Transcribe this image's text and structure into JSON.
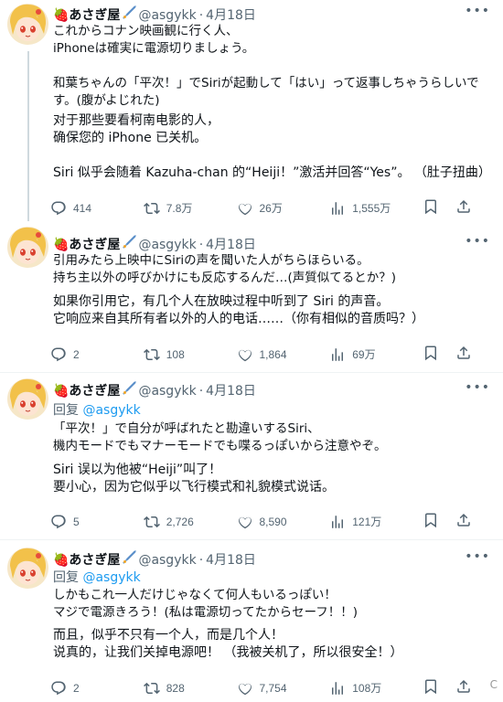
{
  "tweets": [
    {
      "name": "🍓あさぎ屋",
      "handle": "@asgykk",
      "date": "4月18日",
      "reply_label": "",
      "reply_mention": "",
      "text_ja": "これからコナン映画観に行く人、\niPhoneは確実に電源切りましょう。\n\n和葉ちゃんの「平次！」でSiriが起動して「はい」って返事しちゃうらしいです。(腹がよじれた)",
      "text_zh": "对于那些要看柯南电影的人，\n确保您的 iPhone 已关机。\n\nSiri 似乎会随着 Kazuha-chan 的“Heiji！”激活并回答“Yes”。 （肚子扭曲）",
      "replies": "414",
      "retweets": "7.8万",
      "likes": "26万",
      "views": "1,555万"
    },
    {
      "name": "🍓あさぎ屋",
      "handle": "@asgykk",
      "date": "4月18日",
      "reply_label": "",
      "reply_mention": "",
      "text_ja": "引用みたら上映中にSiriの声を聞いた人がちらほらいる。\n持ち主以外の呼びかけにも反応するんだ…(声質似てるとか？)",
      "text_zh": "如果你引用它，有几个人在放映过程中听到了 Siri 的声音。\n它响应来自其所有者以外的人的电话……（你有相似的音质吗？）",
      "replies": "2",
      "retweets": "108",
      "likes": "1,864",
      "views": "69万"
    },
    {
      "name": "🍓あさぎ屋",
      "handle": "@asgykk",
      "date": "4月18日",
      "reply_label": "回复 ",
      "reply_mention": "@asgykk",
      "text_ja": "「平次！」で自分が呼ばれたと勘違いするSiri、\n機内モードでもマナーモードでも喋るっぽいから注意やぞ。",
      "text_zh": "Siri 误以为他被“Heiji”叫了！\n要小心，因为它似乎以飞行模式和礼貌模式说话。",
      "replies": "5",
      "retweets": "2,726",
      "likes": "8,590",
      "views": "121万"
    },
    {
      "name": "🍓あさぎ屋",
      "handle": "@asgykk",
      "date": "4月18日",
      "reply_label": "回复 ",
      "reply_mention": "@asgykk",
      "text_ja": "しかもこれ一人だけじゃなくて何人もいるっぽい！\nマジで電源きろう！(私は電源切ってたからセーフ！！)",
      "text_zh": "而且，似乎不只有一个人，而是几个人！\n说真的，让我们关掉电源吧！ （我被关机了，所以很安全！）",
      "replies": "2",
      "retweets": "828",
      "likes": "7,754",
      "views": "108万"
    }
  ],
  "corner_mark": "C",
  "colors": {
    "text": "#0f1419",
    "muted": "#536471",
    "link": "#1d9bf0",
    "line": "#cfd9de"
  },
  "icons": [
    "more-icon",
    "reply-icon",
    "retweet-icon",
    "like-icon",
    "views-icon",
    "bookmark-icon",
    "share-icon",
    "rocket-badge-icon"
  ]
}
